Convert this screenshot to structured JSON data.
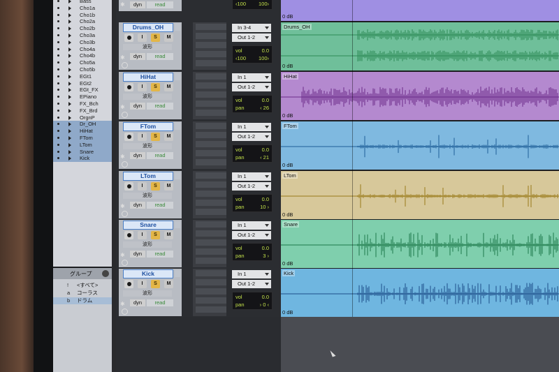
{
  "tracklist": [
    {
      "name": "Bass",
      "selected": false
    },
    {
      "name": "Cho1a",
      "selected": false
    },
    {
      "name": "Cho1b",
      "selected": false
    },
    {
      "name": "Cho2a",
      "selected": false
    },
    {
      "name": "Cho2b",
      "selected": false
    },
    {
      "name": "Cho3a",
      "selected": false
    },
    {
      "name": "Cho3b",
      "selected": false
    },
    {
      "name": "Cho4a",
      "selected": false
    },
    {
      "name": "Cho4b",
      "selected": false
    },
    {
      "name": "Cho5a",
      "selected": false
    },
    {
      "name": "Cho5b",
      "selected": false
    },
    {
      "name": "EGt1",
      "selected": false
    },
    {
      "name": "EGt2",
      "selected": false
    },
    {
      "name": "EGt_FX",
      "selected": false
    },
    {
      "name": "EPiano",
      "selected": false
    },
    {
      "name": "FX_Bch",
      "selected": false
    },
    {
      "name": "FX_Brd",
      "selected": false
    },
    {
      "name": "OrgnP",
      "selected": false
    },
    {
      "name": "Dr_OH",
      "selected": true
    },
    {
      "name": "HiHat",
      "selected": true
    },
    {
      "name": "FTom",
      "selected": true
    },
    {
      "name": "LTom",
      "selected": true
    },
    {
      "name": "Snare",
      "selected": true
    },
    {
      "name": "Kick",
      "selected": true
    }
  ],
  "groups": {
    "title": "グループ",
    "items": [
      {
        "key": "!",
        "name": "<すべて>",
        "selected": false
      },
      {
        "key": "a",
        "name": "コーラス",
        "selected": false
      },
      {
        "key": "b",
        "name": "ドラム",
        "selected": true
      }
    ]
  },
  "top_partial": {
    "dyn": "dyn",
    "read": "read",
    "vol_l": "‹100",
    "vol_r": "100›",
    "db": "0 dB"
  },
  "tracks": [
    {
      "name": "Drums_OH",
      "wave": "波形",
      "dyn": "dyn",
      "read": "read",
      "input": "In 3-4",
      "output": "Out 1-2",
      "vol_label": "vol",
      "vol": "0.0",
      "pan_label": "",
      "pan": "",
      "pan_l": "‹100",
      "pan_r": "100›",
      "db": "0 dB",
      "lane_name": "Drums_OH",
      "color": "#6fbf9a",
      "wave_color": "#2e8b57"
    },
    {
      "name": "HiHat",
      "wave": "波形",
      "dyn": "dyn",
      "read": "read",
      "input": "In 1",
      "output": "Out 1-2",
      "vol_label": "vol",
      "vol": "0.0",
      "pan_label": "pan",
      "pan": "‹ 26",
      "pan_l": "",
      "pan_r": "",
      "db": "0 dB",
      "lane_name": "HiHat",
      "color": "#b489cf",
      "wave_color": "#6b2a8a"
    },
    {
      "name": "FTom",
      "wave": "波形",
      "dyn": "dyn",
      "read": "read",
      "input": "In 1",
      "output": "Out 1-2",
      "vol_label": "vol",
      "vol": "0.0",
      "pan_label": "pan",
      "pan": "‹ 21",
      "pan_l": "",
      "pan_r": "",
      "db": "0 dB",
      "lane_name": "FTom",
      "color": "#7fb9e0",
      "wave_color": "#1f5f99"
    },
    {
      "name": "LTom",
      "wave": "波形",
      "dyn": "dyn",
      "read": "read",
      "input": "In 1",
      "output": "Out 1-2",
      "vol_label": "vol",
      "vol": "0.0",
      "pan_label": "pan",
      "pan": "10 ›",
      "pan_l": "",
      "pan_r": "",
      "db": "0 dB",
      "lane_name": "LTom",
      "color": "#d7c89a",
      "wave_color": "#9a7a1a"
    },
    {
      "name": "Snare",
      "wave": "波形",
      "dyn": "dyn",
      "read": "read",
      "input": "In 1",
      "output": "Out 1-2",
      "vol_label": "vol",
      "vol": "0.0",
      "pan_label": "pan",
      "pan": "3 ›",
      "pan_l": "",
      "pan_r": "",
      "db": "0 dB",
      "lane_name": "Snare",
      "color": "#7fcfad",
      "wave_color": "#1e7a4a"
    },
    {
      "name": "Kick",
      "wave": "波形",
      "dyn": "dyn",
      "read": "read",
      "input": "In 1",
      "output": "Out 1-2",
      "vol_label": "vol",
      "vol": "0.0",
      "pan_label": "pan",
      "pan": "› 0 ‹",
      "pan_l": "",
      "pan_r": "",
      "db": "0 dB",
      "lane_name": "Kick",
      "color": "#6fb6e0",
      "wave_color": "#1d4f8a"
    }
  ],
  "buttons": {
    "input": "I",
    "solo": "S",
    "mute": "M"
  }
}
